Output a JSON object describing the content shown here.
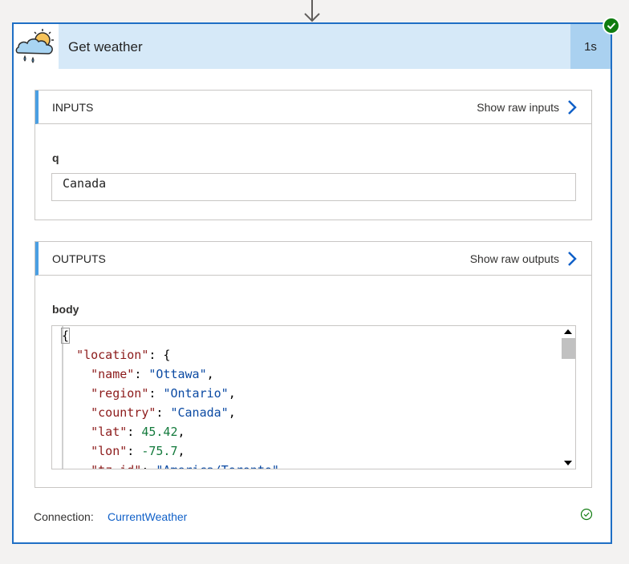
{
  "card": {
    "title": "Get weather",
    "duration": "1s",
    "icon": "weather-sun-cloud-rain-icon",
    "status_icon": "success-check-icon",
    "accent_color": "#1f6fc5",
    "header_color": "#d6e9f8"
  },
  "inputs": {
    "title": "INPUTS",
    "raw_link": "Show raw inputs",
    "field_label": "q",
    "field_value": "Canada"
  },
  "outputs": {
    "title": "OUTPUTS",
    "raw_link": "Show raw outputs",
    "field_label": "body",
    "json_lines": [
      "{",
      "  \"location\": {",
      "    \"name\": \"Ottawa\",",
      "    \"region\": \"Ontario\",",
      "    \"country\": \"Canada\",",
      "    \"lat\": 45.42,",
      "    \"lon\": -75.7,",
      "    \"tz_id\": \"America/Toronto\","
    ]
  },
  "connection": {
    "label": "Connection:",
    "value": "CurrentWeather",
    "status_icon": "connection-ok-icon"
  }
}
